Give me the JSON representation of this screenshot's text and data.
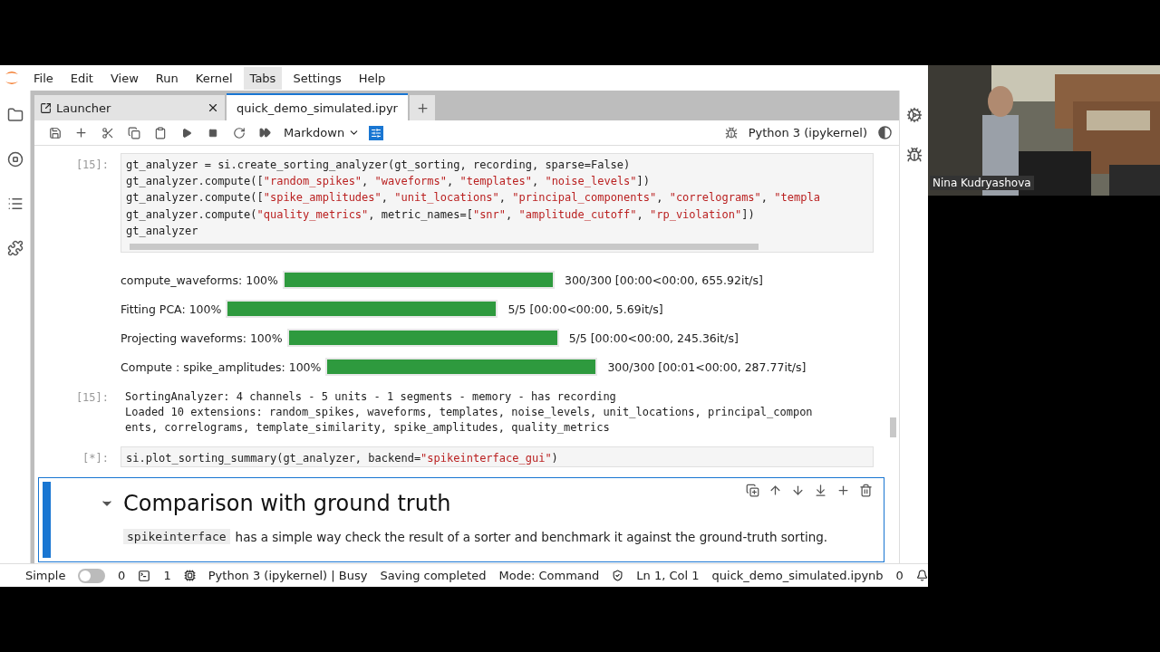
{
  "menu": [
    {
      "label": "File",
      "selected": false
    },
    {
      "label": "Edit",
      "selected": false
    },
    {
      "label": "View",
      "selected": false
    },
    {
      "label": "Run",
      "selected": false
    },
    {
      "label": "Kernel",
      "selected": false
    },
    {
      "label": "Tabs",
      "selected": true
    },
    {
      "label": "Settings",
      "selected": false
    },
    {
      "label": "Help",
      "selected": false
    }
  ],
  "tabs": [
    {
      "label": "Launcher",
      "kind": "launcher",
      "selected": false
    },
    {
      "label": "quick_demo_simulated.ipyr",
      "kind": "notebook",
      "selected": true
    }
  ],
  "toolbar": {
    "cell_type": "Markdown",
    "kernel": "Python 3 (ipykernel)"
  },
  "cells": [
    {
      "kind": "code",
      "prompt": "[15]:",
      "lines": [
        "gt_analyzer = si.create_sorting_analyzer(gt_sorting, recording, sparse=False)",
        "gt_analyzer.compute([\"random_spikes\", \"waveforms\", \"templates\", \"noise_levels\"])",
        "gt_analyzer.compute([\"spike_amplitudes\", \"unit_locations\", \"principal_components\", \"correlograms\", \"templa",
        "gt_analyzer.compute(\"quality_metrics\", metric_names=[\"snr\", \"amplitude_cutoff\", \"rp_violation\"])",
        "gt_analyzer"
      ]
    },
    {
      "kind": "progress",
      "rows": [
        {
          "label": "compute_waveforms: 100%",
          "level": 1,
          "reading": "300/300  [00:00<00:00,  655.92it/s]"
        },
        {
          "label": "Fitting  PCA: 100%",
          "level": 1,
          "reading": "5/5  [00:00<00:00,    5.69it/s]"
        },
        {
          "label": "Projecting  waveforms: 100%",
          "level": 1,
          "reading": "5/5  [00:00<00:00,  245.36it/s]"
        },
        {
          "label": "Compute  :  spike_amplitudes: 100%",
          "level": 1,
          "reading": "300/300  [00:01<00:00,  287.77it/s]"
        }
      ]
    },
    {
      "kind": "output",
      "prompt": "[15]:",
      "lines": [
        "SortingAnalyzer: 4 channels - 5 units - 1 segments - memory - has recording",
        "Loaded 10 extensions: random_spikes, waveforms, templates, noise_levels, unit_locations, principal_compon",
        "ents, correlograms, template_similarity, spike_amplitudes, quality_metrics"
      ]
    },
    {
      "kind": "code",
      "prompt": "[*]:",
      "lines": [
        "si.plot_sorting_summary(gt_analyzer, backend=\"spikeinterface_gui\")"
      ]
    },
    {
      "kind": "markdown",
      "selected": true,
      "heading": "Comparison with ground truth",
      "code_word": "spikeinterface",
      "text": "has a simple way check the result of a sorter and benchmark it against the ground-truth sorting."
    }
  ],
  "status_bar": {
    "mode_label": "Simple",
    "simple_on": false,
    "terminals": "0",
    "kernels": "1",
    "kernel_status": "Python 3 (ipykernel) | Busy",
    "save_status": "Saving completed",
    "mode": "Mode: Command",
    "position": "Ln 1, Col 1",
    "file": "quick_demo_simulated.ipynb",
    "notifications": "0"
  },
  "video": {
    "kind": "picture",
    "speaker": "Nina Kudryashova"
  }
}
